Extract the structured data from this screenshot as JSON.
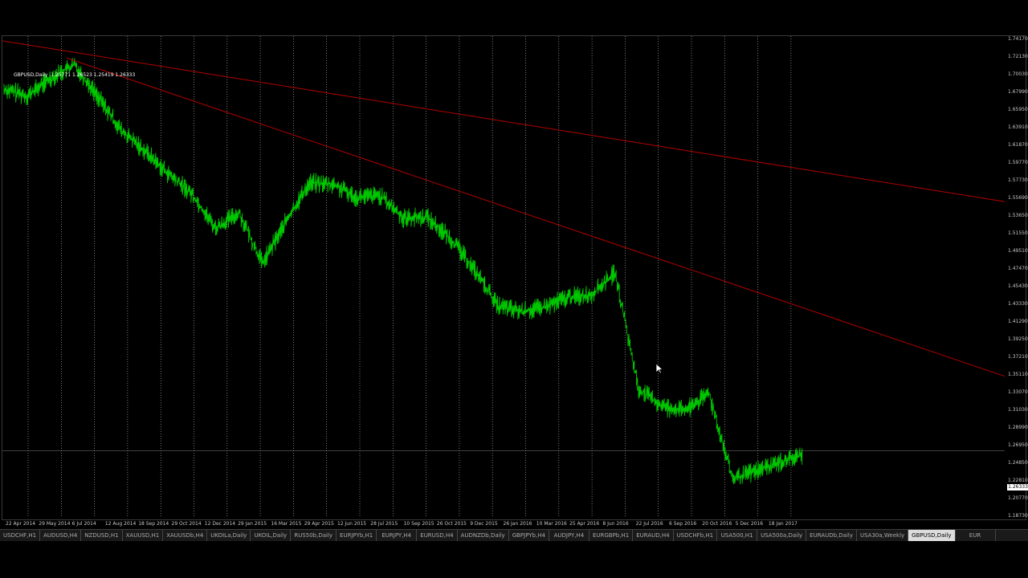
{
  "chart_header": {
    "symbol": "GBPUSD,Daily",
    "ohlc": "1.25771 1.26523 1.25419 1.26333"
  },
  "current_price": "1.26333",
  "price_axis": [
    "1.74170",
    "1.72130",
    "1.70030",
    "1.67990",
    "1.65950",
    "1.63910",
    "1.61870",
    "1.59770",
    "1.57730",
    "1.55690",
    "1.53650",
    "1.51550",
    "1.49510",
    "1.47470",
    "1.45430",
    "1.43330",
    "1.41290",
    "1.39250",
    "1.37210",
    "1.35110",
    "1.33070",
    "1.31030",
    "1.28990",
    "1.26950",
    "1.24850",
    "1.22810",
    "1.20770",
    "1.18730"
  ],
  "date_axis": [
    "22 Apr 2014",
    "29 May 2014",
    "6 Jul 2014",
    "12 Aug 2014",
    "18 Sep 2014",
    "29 Oct 2014",
    "12 Dec 2014",
    "29 Jan 2015",
    "16 Mar 2015",
    "29 Apr 2015",
    "12 Jun 2015",
    "28 Jul 2015",
    "10 Sep 2015",
    "26 Oct 2015",
    "9 Dec 2015",
    "26 Jan 2016",
    "10 Mar 2016",
    "25 Apr 2016",
    "8 Jun 2016",
    "22 Jul 2016",
    "6 Sep 2016",
    "20 Oct 2016",
    "5 Dec 2016",
    "18 Jan 2017"
  ],
  "tabs": [
    {
      "label": "USDCHF,H1",
      "active": false
    },
    {
      "label": "AUDUSD,H4",
      "active": false
    },
    {
      "label": "NZDUSD,H1",
      "active": false
    },
    {
      "label": "XAUUSD,H1",
      "active": false
    },
    {
      "label": "XAUUSDb,H4",
      "active": false
    },
    {
      "label": "UKOILa,Daily",
      "active": false
    },
    {
      "label": "UKOIL,Daily",
      "active": false
    },
    {
      "label": "RUS50b,Daily",
      "active": false
    },
    {
      "label": "EURJPYb,H1",
      "active": false
    },
    {
      "label": "EURJPY,H4",
      "active": false
    },
    {
      "label": "EURUSD,H4",
      "active": false
    },
    {
      "label": "AUDNZDb,Daily",
      "active": false
    },
    {
      "label": "GBPJPYb,H4",
      "active": false
    },
    {
      "label": "AUDJPY,H4",
      "active": false
    },
    {
      "label": "EURGBPb,H1",
      "active": false
    },
    {
      "label": "EURAUD,H4",
      "active": false
    },
    {
      "label": "USDCHFb,H1",
      "active": false
    },
    {
      "label": "USA500,H1",
      "active": false
    },
    {
      "label": "USA500a,Daily",
      "active": false
    },
    {
      "label": "EURAUDb,Daily",
      "active": false
    },
    {
      "label": "USA30a,Weekly",
      "active": false
    },
    {
      "label": "GBPUSD,Daily",
      "active": true
    },
    {
      "label": "EUR",
      "active": false
    }
  ],
  "chart_data": {
    "type": "line",
    "symbol": "GBPUSD",
    "timeframe": "Daily",
    "x": [
      "2014-04",
      "2014-05",
      "2014-06",
      "2014-07",
      "2014-08",
      "2014-09",
      "2014-10",
      "2014-11",
      "2014-12",
      "2015-01",
      "2015-02",
      "2015-03",
      "2015-04",
      "2015-05",
      "2015-06",
      "2015-07",
      "2015-08",
      "2015-09",
      "2015-10",
      "2015-11",
      "2015-12",
      "2016-01",
      "2016-02",
      "2016-03",
      "2016-04",
      "2016-05",
      "2016-06",
      "2016-06b",
      "2016-07",
      "2016-08",
      "2016-09",
      "2016-10",
      "2016-11",
      "2016-12",
      "2017-01"
    ],
    "close": [
      1.684,
      1.676,
      1.697,
      1.712,
      1.675,
      1.635,
      1.612,
      1.585,
      1.562,
      1.522,
      1.54,
      1.481,
      1.53,
      1.575,
      1.573,
      1.558,
      1.56,
      1.534,
      1.535,
      1.51,
      1.475,
      1.432,
      1.425,
      1.43,
      1.442,
      1.445,
      1.47,
      1.335,
      1.315,
      1.31,
      1.33,
      1.23,
      1.24,
      1.25,
      1.258
    ],
    "series_color": "#00c800",
    "trendlines": [
      {
        "color": "#b40000",
        "from": [
          "2014-04",
          1.74
        ],
        "to": [
          "2017-03",
          1.553
        ]
      },
      {
        "color": "#b40000",
        "from": [
          "2014-06",
          1.72
        ],
        "to": [
          "2017-03",
          1.35
        ]
      }
    ],
    "ylim": [
      1.1873,
      1.7417
    ],
    "grid": "vertical dashed",
    "current_price_line": 1.26333
  }
}
